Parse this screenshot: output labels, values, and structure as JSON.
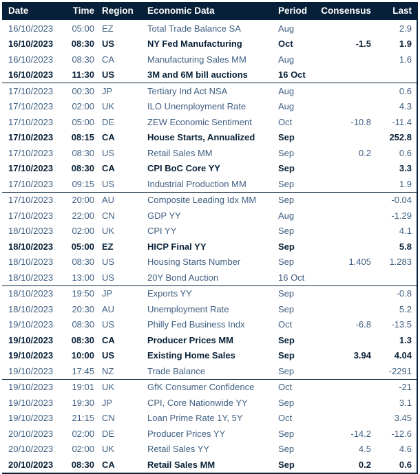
{
  "table": {
    "columns": [
      {
        "key": "date",
        "label": "Date",
        "align": "left"
      },
      {
        "key": "time",
        "label": "Time",
        "align": "right"
      },
      {
        "key": "region",
        "label": "Region",
        "align": "left"
      },
      {
        "key": "data",
        "label": "Economic Data",
        "align": "left"
      },
      {
        "key": "period",
        "label": "Period",
        "align": "left"
      },
      {
        "key": "consensus",
        "label": "Consensus",
        "align": "right"
      },
      {
        "key": "last",
        "label": "Last",
        "align": "right"
      }
    ],
    "header_background": "#06203a",
    "header_text_color": "#ffffff",
    "row_text_color": "#3f5f81",
    "highlight_text_color": "#0a2239",
    "border_color": "#0a2239",
    "rows": [
      {
        "date": "16/10/2023",
        "time": "05:00",
        "region": "EZ",
        "data": "Total Trade Balance SA",
        "period": "Aug",
        "consensus": "",
        "last": "2.9",
        "highlight": false,
        "group_end": false
      },
      {
        "date": "16/10/2023",
        "time": "08:30",
        "region": "US",
        "data": "NY Fed Manufacturing",
        "period": "Oct",
        "consensus": "-1.5",
        "last": "1.9",
        "highlight": true,
        "group_end": false
      },
      {
        "date": "16/10/2023",
        "time": "08:30",
        "region": "CA",
        "data": "Manufacturing Sales MM",
        "period": "Aug",
        "consensus": "",
        "last": "1.6",
        "highlight": false,
        "group_end": false
      },
      {
        "date": "16/10/2023",
        "time": "11:30",
        "region": "US",
        "data": "3M and 6M bill auctions",
        "period": "16 Oct",
        "consensus": "",
        "last": "",
        "highlight": true,
        "group_end": true
      },
      {
        "date": "17/10/2023",
        "time": "00:30",
        "region": "JP",
        "data": "Tertiary Ind Act NSA",
        "period": "Aug",
        "consensus": "",
        "last": "0.6",
        "highlight": false,
        "group_end": false
      },
      {
        "date": "17/10/2023",
        "time": "02:00",
        "region": "UK",
        "data": "ILO Unemployment Rate",
        "period": "Aug",
        "consensus": "",
        "last": "4.3",
        "highlight": false,
        "group_end": false
      },
      {
        "date": "17/10/2023",
        "time": "05:00",
        "region": "DE",
        "data": "ZEW Economic Sentiment",
        "period": "Oct",
        "consensus": "-10.8",
        "last": "-11.4",
        "highlight": false,
        "group_end": false
      },
      {
        "date": "17/10/2023",
        "time": "08:15",
        "region": "CA",
        "data": "House Starts, Annualized",
        "period": "Sep",
        "consensus": "",
        "last": "252.8",
        "highlight": true,
        "group_end": false
      },
      {
        "date": "17/10/2023",
        "time": "08:30",
        "region": "US",
        "data": "Retail Sales MM",
        "period": "Sep",
        "consensus": "0.2",
        "last": "0.6",
        "highlight": false,
        "group_end": false
      },
      {
        "date": "17/10/2023",
        "time": "08:30",
        "region": "CA",
        "data": "CPI BoC Core YY",
        "period": "Sep",
        "consensus": "",
        "last": "3.3",
        "highlight": true,
        "group_end": false
      },
      {
        "date": "17/10/2023",
        "time": "09:15",
        "region": "US",
        "data": "Industrial Production MM",
        "period": "Sep",
        "consensus": "",
        "last": "1.9",
        "highlight": false,
        "group_end": true
      },
      {
        "date": "17/10/2023",
        "time": "20:00",
        "region": "AU",
        "data": "Composite Leading Idx MM",
        "period": "Sep",
        "consensus": "",
        "last": "-0.04",
        "highlight": false,
        "group_end": false
      },
      {
        "date": "17/10/2023",
        "time": "22:00",
        "region": "CN",
        "data": "GDP YY",
        "period": "Aug",
        "consensus": "",
        "last": "-1.29",
        "highlight": false,
        "group_end": false
      },
      {
        "date": "18/10/2023",
        "time": "02:00",
        "region": "UK",
        "data": "CPI YY",
        "period": "Sep",
        "consensus": "",
        "last": "4.1",
        "highlight": false,
        "group_end": false
      },
      {
        "date": "18/10/2023",
        "time": "05:00",
        "region": "EZ",
        "data": "HICP Final YY",
        "period": "Sep",
        "consensus": "",
        "last": "5.8",
        "highlight": true,
        "group_end": false
      },
      {
        "date": "18/10/2023",
        "time": "08:30",
        "region": "US",
        "data": "Housing Starts Number",
        "period": "Sep",
        "consensus": "1.405",
        "last": "1.283",
        "highlight": false,
        "group_end": false
      },
      {
        "date": "18/10/2023",
        "time": "13:00",
        "region": "US",
        "data": "20Y Bond Auction",
        "period": "16 Oct",
        "consensus": "",
        "last": "",
        "highlight": false,
        "group_end": true
      },
      {
        "date": "18/10/2023",
        "time": "19:50",
        "region": "JP",
        "data": "Exports YY",
        "period": "Sep",
        "consensus": "",
        "last": "-0.8",
        "highlight": false,
        "group_end": false
      },
      {
        "date": "18/10/2023",
        "time": "20:30",
        "region": "AU",
        "data": "Unemployment Rate",
        "period": "Sep",
        "consensus": "",
        "last": "5.2",
        "highlight": false,
        "group_end": false
      },
      {
        "date": "19/10/2023",
        "time": "08:30",
        "region": "US",
        "data": "Philly Fed Business Indx",
        "period": "Oct",
        "consensus": "-6.8",
        "last": "-13.5",
        "highlight": false,
        "group_end": false
      },
      {
        "date": "19/10/2023",
        "time": "08:30",
        "region": "CA",
        "data": "Producer Prices MM",
        "period": "Sep",
        "consensus": "",
        "last": "1.3",
        "highlight": true,
        "group_end": false
      },
      {
        "date": "19/10/2023",
        "time": "10:00",
        "region": "US",
        "data": "Existing Home Sales",
        "period": "Sep",
        "consensus": "3.94",
        "last": "4.04",
        "highlight": true,
        "group_end": false
      },
      {
        "date": "19/10/2023",
        "time": "17:45",
        "region": "NZ",
        "data": "Trade Balance",
        "period": "Sep",
        "consensus": "",
        "last": "-2291",
        "highlight": false,
        "group_end": true
      },
      {
        "date": "19/10/2023",
        "time": "19:01",
        "region": "UK",
        "data": "GfK Consumer Confidence",
        "period": "Oct",
        "consensus": "",
        "last": "-21",
        "highlight": false,
        "group_end": false
      },
      {
        "date": "19/10/2023",
        "time": "19:30",
        "region": "JP",
        "data": "CPI, Core Nationwide YY",
        "period": "Sep",
        "consensus": "",
        "last": "3.1",
        "highlight": false,
        "group_end": false
      },
      {
        "date": "19/10/2023",
        "time": "21:15",
        "region": "CN",
        "data": "Loan Prime Rate 1Y, 5Y",
        "period": "Oct",
        "consensus": "",
        "last": "3.45",
        "highlight": false,
        "group_end": false
      },
      {
        "date": "20/10/2023",
        "time": "02:00",
        "region": "DE",
        "data": "Producer Prices YY",
        "period": "Sep",
        "consensus": "-14.2",
        "last": "-12.6",
        "highlight": false,
        "group_end": false
      },
      {
        "date": "20/10/2023",
        "time": "02:00",
        "region": "UK",
        "data": "Retail Sales YY",
        "period": "Sep",
        "consensus": "4.5",
        "last": "4.6",
        "highlight": false,
        "group_end": false
      },
      {
        "date": "20/10/2023",
        "time": "08:30",
        "region": "CA",
        "data": "Retail Sales MM",
        "period": "Sep",
        "consensus": "0.2",
        "last": "0.6",
        "highlight": true,
        "group_end": false
      }
    ]
  }
}
